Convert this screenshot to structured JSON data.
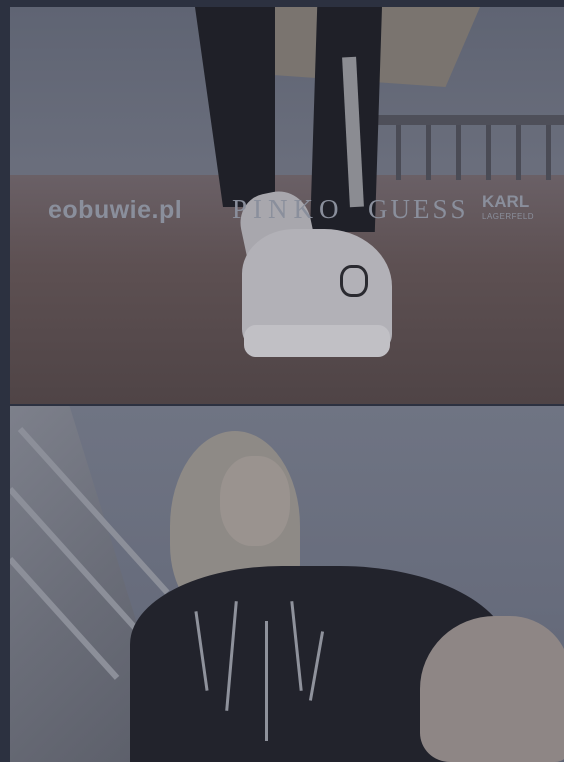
{
  "banners": {
    "top": {
      "alt": "Sneakers campaign",
      "logos": {
        "eobuwie": "eobuwie.pl",
        "pinko": "PINKO",
        "guess": "GUESS",
        "karl": "KARL",
        "karl_sub": "LAGERFELD"
      }
    },
    "bottom": {
      "alt": "PINKO sweater campaign"
    }
  },
  "colors": {
    "background": "#2c3140",
    "overlay": "#2c3140",
    "logo": "#8a8f9c"
  }
}
